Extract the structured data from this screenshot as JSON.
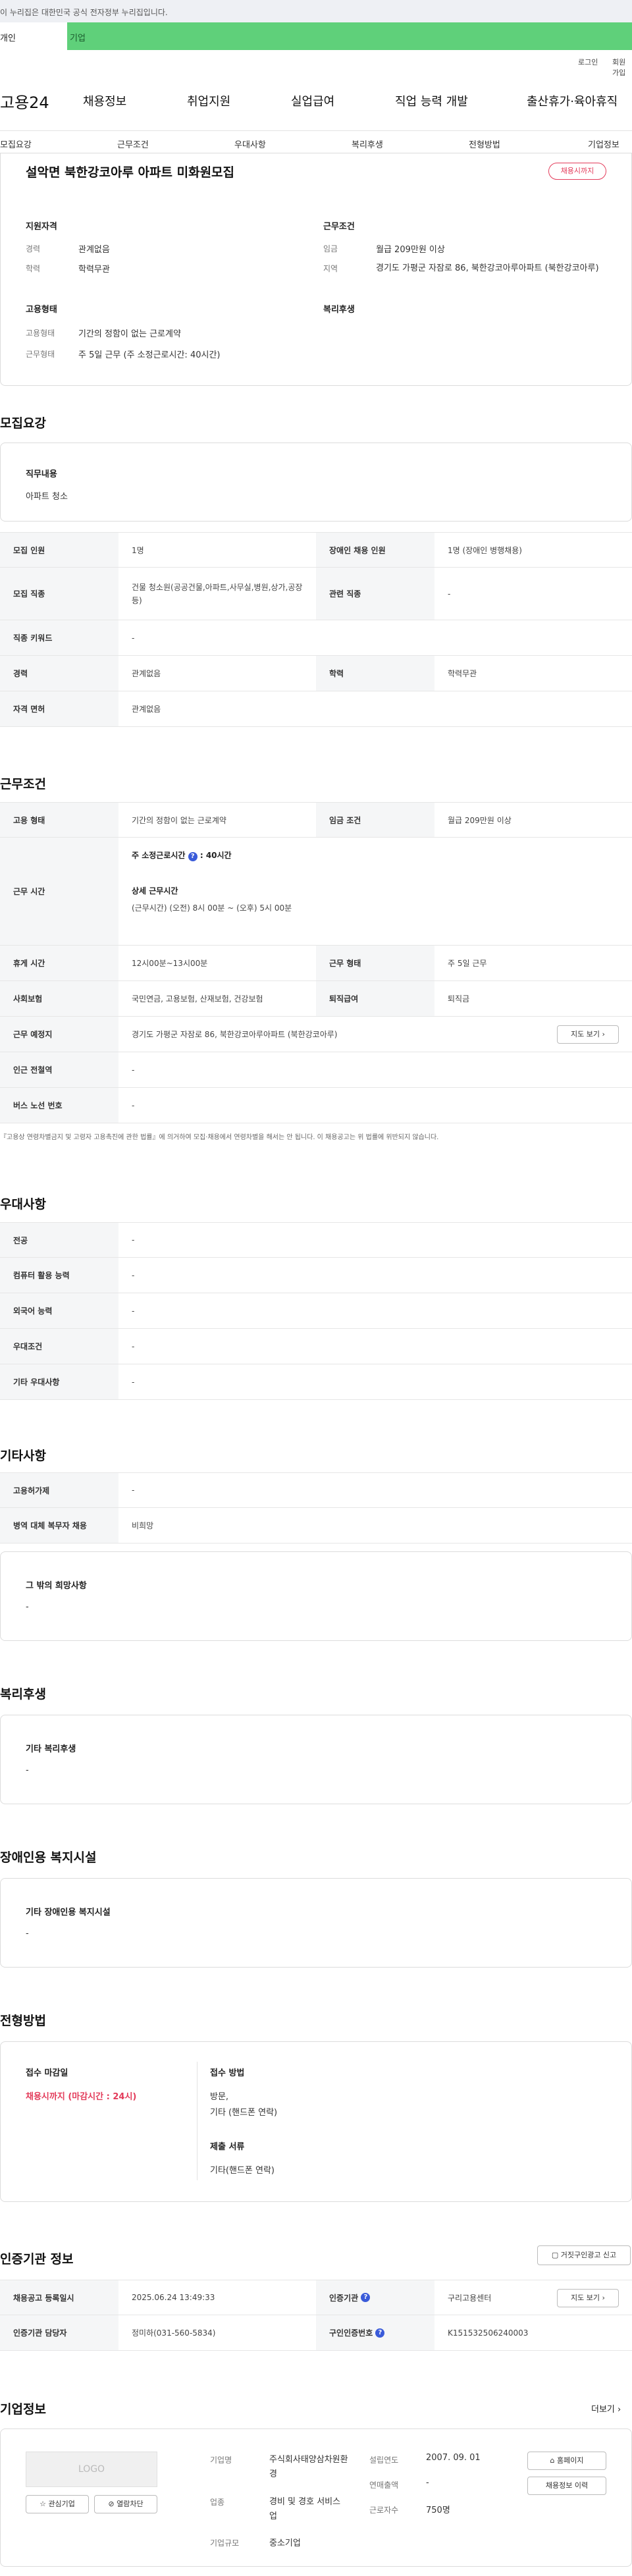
{
  "gov_banner": "이 누리집은 대한민국 공식 전자정부 누리집입니다.",
  "tabs": {
    "personal": "개인",
    "company": "기업"
  },
  "util": {
    "login": "로그인",
    "join": "회원가입"
  },
  "gnb": {
    "logo": "고용24",
    "items": [
      "채용정보",
      "취업지원",
      "실업급여",
      "직업 능력 개발",
      "출산휴가·육아휴직"
    ]
  },
  "anchor_nav": [
    "모집요강",
    "근무조건",
    "우대사항",
    "복리후생",
    "전형방법",
    "기업정보"
  ],
  "header": {
    "title": "설악면 북한강코아루 아파트 미화원모집",
    "badge": "채용시까지",
    "apply_title": "지원자격",
    "apply": [
      {
        "label": "경력",
        "value": "관계없음"
      },
      {
        "label": "학력",
        "value": "학력무관"
      }
    ],
    "work_title": "근무조건",
    "work": [
      {
        "label": "임금",
        "value": "월급 209만원 이상"
      },
      {
        "label": "지역",
        "value": "경기도 가평군 자잠로 86, 북한강코아루아파트 (북한강코아루)"
      }
    ],
    "emp_title": "고용형태",
    "emp": [
      {
        "label": "고용형태",
        "value": "기간의 정함이 없는 근로계약"
      },
      {
        "label": "근무형태",
        "value": "주 5일 근무 (주 소정근로시간: 40시간)"
      }
    ],
    "welfare_title": "복리후생"
  },
  "recruit": {
    "title": "모집요강",
    "job_label": "직무내용",
    "job_value": "아파트 청소",
    "rows": {
      "headcount_label": "모집 인원",
      "headcount": "1명",
      "disabled_label": "장애인 채용 인원",
      "disabled": "1명 (장애인 병행채용)",
      "job_type_label": "모집 직종",
      "job_type": "건물 청소원(공공건물,아파트,사무실,병원,상가,공장 등)",
      "related_label": "관련 직종",
      "related": "-",
      "keyword_label": "직종 키워드",
      "keyword": "-",
      "career_label": "경력",
      "career": "관계없음",
      "edu_label": "학력",
      "edu": "학력무관",
      "license_label": "자격 면허",
      "license": "관계없음"
    }
  },
  "conditions": {
    "title": "근무조건",
    "emp_type_label": "고용 형태",
    "emp_type": "기간의 정함이 없는 근로계약",
    "wage_label": "임금 조건",
    "wage": "월급 209만원 이상",
    "hours_label": "근무 시간",
    "hours_weekly_label": "주 소정근로시간",
    "hours_weekly": ": 40시간",
    "hours_detail_label": "상세 근무시간",
    "hours_detail": "(근무시간) (오전) 8시 00분 ~ (오후) 5시 00분",
    "break_label": "휴게 시간",
    "break": "12시00분~13시00분",
    "work_form_label": "근무 형태",
    "work_form": "주 5일 근무",
    "insurance_label": "사회보험",
    "insurance": "국민연금, 고용보험, 산재보험, 건강보험",
    "severance_label": "퇴직급여",
    "severance": "퇴직금",
    "place_label": "근무 예정지",
    "place": "경기도 가평군 자잠로 86, 북한강코아루아파트 (북한강코아루)",
    "map_btn": "지도 보기",
    "subway_label": "인근 전철역",
    "subway": "-",
    "bus_label": "버스 노선 번호",
    "bus": "-",
    "note": "『고용상 연령차별금지 및 고령자 고용촉진에 관한 법률』에 의거하여 모집·채용에서 연령차별을 해서는 안 됩니다. 이 채용공고는 위 법률에 위반되지 않습니다."
  },
  "pref": {
    "title": "우대사항",
    "rows": [
      {
        "label": "전공",
        "value": "-"
      },
      {
        "label": "컴퓨터 활용 능력",
        "value": "-"
      },
      {
        "label": "외국어 능력",
        "value": "-"
      },
      {
        "label": "우대조건",
        "value": "-"
      },
      {
        "label": "기타 우대사항",
        "value": "-"
      }
    ]
  },
  "etc": {
    "title": "기타사항",
    "rows": [
      {
        "label": "고용허가제",
        "value": "-"
      },
      {
        "label": "병역 대체 복무자 채용",
        "value": "비희망"
      }
    ],
    "hope_label": "그 밖의 희망사항",
    "hope_value": "-"
  },
  "welfare": {
    "title": "복리후생",
    "label": "기타 복리후생",
    "value": "-"
  },
  "disabled_fac": {
    "title": "장애인용 복지시설",
    "label": "기타 장애인용 복지시설",
    "value": "-"
  },
  "selection": {
    "title": "전형방법",
    "deadline_label": "접수 마감일",
    "deadline": "채용시까지 (마감시간 : 24시)",
    "method_label": "접수 방법",
    "method": "방문,",
    "method2": "기타 (핸드폰 연락)",
    "docs_label": "제출 서류",
    "docs": "기타(핸드폰 연락)"
  },
  "agency": {
    "title": "인증기관 정보",
    "report_btn": "거짓구인광고 신고",
    "reg_label": "채용공고 등록일시",
    "reg": "2025.06.24 13:49:33",
    "org_label": "인증기관",
    "org": "구리고용센터",
    "map_btn": "지도 보기",
    "manager_label": "인증기관 담당자",
    "manager": "정미하(031-560-5834)",
    "no_label": "구인인증번호",
    "no": "K151532506240003"
  },
  "company": {
    "title": "기업정보",
    "more": "더보기",
    "logo": "LOGO",
    "interest_btn": "관심기업",
    "block_btn": "열람차단",
    "name_label": "기업명",
    "name": "주식회사태양삼차원환경",
    "industry_label": "업종",
    "industry": "경비 및 경호 서비스업",
    "size_label": "기업규모",
    "size": "중소기업",
    "found_label": "설립연도",
    "found": "2007. 09. 01",
    "sales_label": "연매출액",
    "sales": "-",
    "emp_label": "근로자수",
    "emp": "750명",
    "home_btn": "홈페이지",
    "history_btn": "채용정보 이력"
  }
}
